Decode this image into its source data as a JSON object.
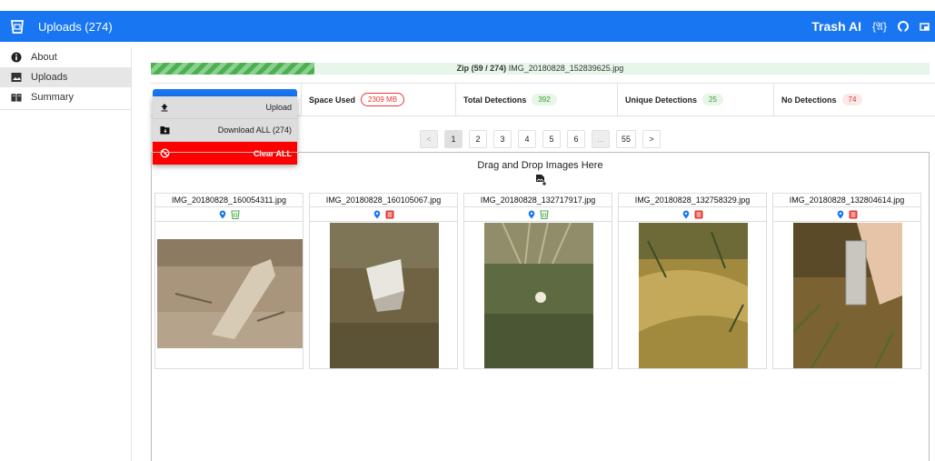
{
  "appbar": {
    "title": "Uploads (274)",
    "brand": "Trash AI",
    "api_icon_text": "{𝔄}"
  },
  "sidebar": {
    "items": [
      {
        "label": "About",
        "icon": "info-icon"
      },
      {
        "label": "Uploads",
        "icon": "image-icon"
      },
      {
        "label": "Summary",
        "icon": "book-icon"
      }
    ]
  },
  "progress": {
    "fraction": 0.21,
    "prefix": "Zip (59 / 274)",
    "file": "IMG_20180828_152839625.jpg"
  },
  "stats": {
    "space_label": "Space Used",
    "space_value": "2309 MB",
    "total_label": "Total Detections",
    "total_value": "392",
    "unique_label": "Unique Detections",
    "unique_value": "25",
    "none_label": "No Detections",
    "none_value": "74"
  },
  "menu": {
    "upload": "Upload",
    "download": "Download ALL (274)",
    "clear": "Clear ALL"
  },
  "pagination": {
    "prev": "<",
    "pages": [
      "1",
      "2",
      "3",
      "4",
      "5",
      "6"
    ],
    "ellipsis": "...",
    "last": "55",
    "next": ">",
    "current": "1"
  },
  "gallery": {
    "drop_text": "Drag and Drop Images Here",
    "cards": [
      {
        "filename": "IMG_20180828_160054311.jpg",
        "status_icon": "trash-can-icon",
        "status_color": "#4caf50"
      },
      {
        "filename": "IMG_20180828_160105067.jpg",
        "status_icon": "detection-list-icon",
        "status_color": "#e53935"
      },
      {
        "filename": "IMG_20180828_132717917.jpg",
        "status_icon": "trash-can-icon",
        "status_color": "#4caf50"
      },
      {
        "filename": "IMG_20180828_132758329.jpg",
        "status_icon": "detection-list-icon",
        "status_color": "#e53935"
      },
      {
        "filename": "IMG_20180828_132804614.jpg",
        "status_icon": "detection-list-icon",
        "status_color": "#e53935"
      }
    ]
  },
  "colors": {
    "primary": "#1976f2",
    "danger": "#ff0000",
    "success": "#4caf50",
    "location": "#1976f2"
  }
}
